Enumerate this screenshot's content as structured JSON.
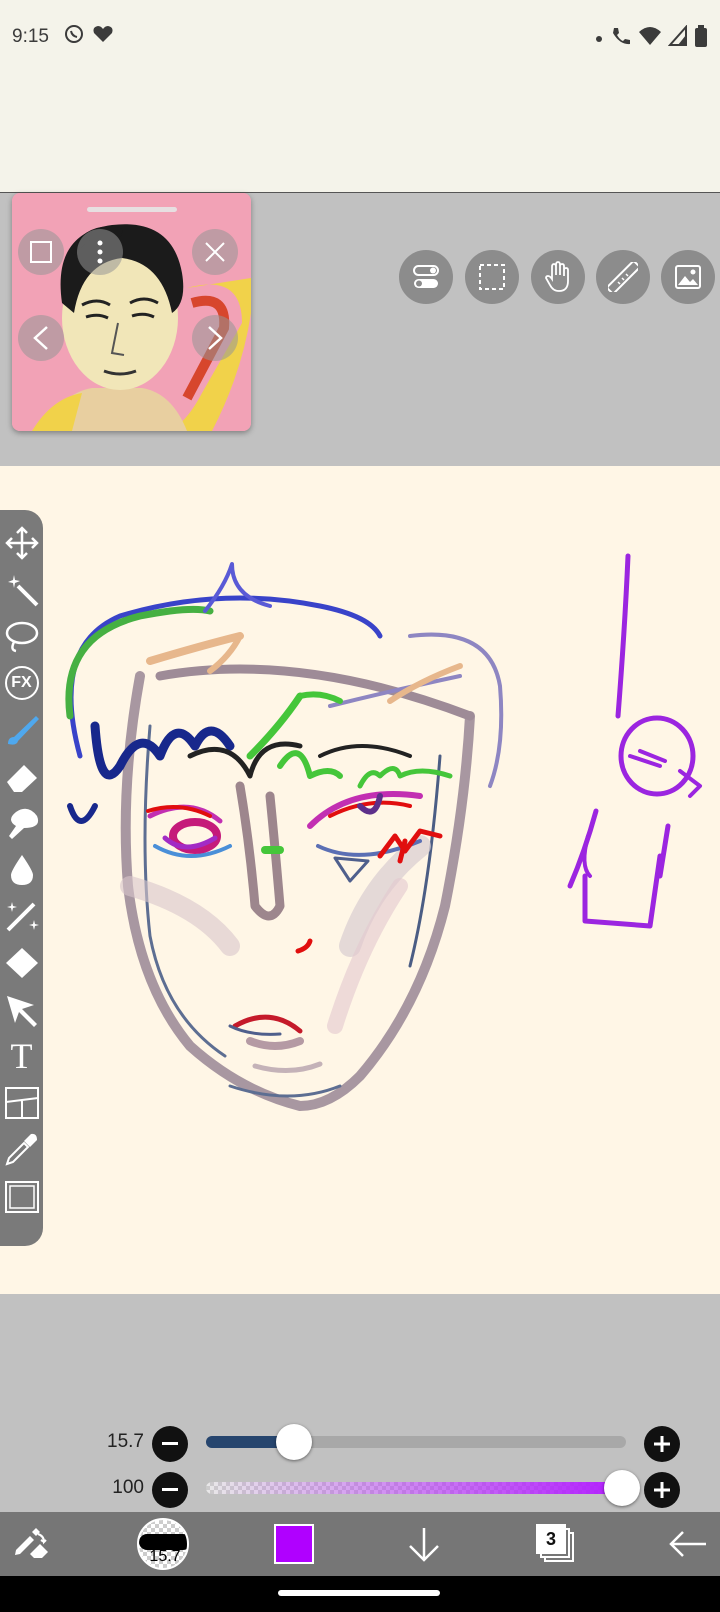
{
  "status_bar": {
    "time": "9:15",
    "left_icons": [
      "whatsapp-icon",
      "heart-icon"
    ],
    "right_icons": [
      "dot-icon",
      "wifi-calling-icon",
      "wifi-icon",
      "signal-icon",
      "battery-icon"
    ]
  },
  "reference_window": {
    "buttons": [
      "layer-toggle-icon",
      "more-vert-icon",
      "close-icon",
      "prev-icon",
      "next-icon"
    ]
  },
  "top_tools": [
    "toggle-settings-icon",
    "selection-icon",
    "hand-icon",
    "ruler-icon",
    "image-reference-icon"
  ],
  "left_toolbar": [
    "move-icon",
    "magic-wand-icon",
    "lasso-icon",
    "fx-icon",
    "brush-icon",
    "eraser-icon",
    "smudge-icon",
    "blur-icon",
    "sparkle-brush-icon",
    "fill-icon",
    "select-arrow-icon",
    "text-icon",
    "frame-divider-icon",
    "eyedropper-icon",
    "canvas-icon"
  ],
  "fx_label": "FX",
  "text_tool_label": "T",
  "size_slider": {
    "label": "15.7",
    "value": 15.7,
    "level": 0.21,
    "color": "#26456e"
  },
  "opacity_slider": {
    "label": "100",
    "value": 100,
    "level": 1.0,
    "color": "#b21cff"
  },
  "bottom_bar": {
    "brush_size_label": "15.7",
    "current_color": "#b000ff",
    "layers_count": "3",
    "icons": [
      "edit-tools-icon",
      "brush-preview-icon",
      "color-swatch",
      "download-icon",
      "layers-icon",
      "back-icon"
    ]
  }
}
